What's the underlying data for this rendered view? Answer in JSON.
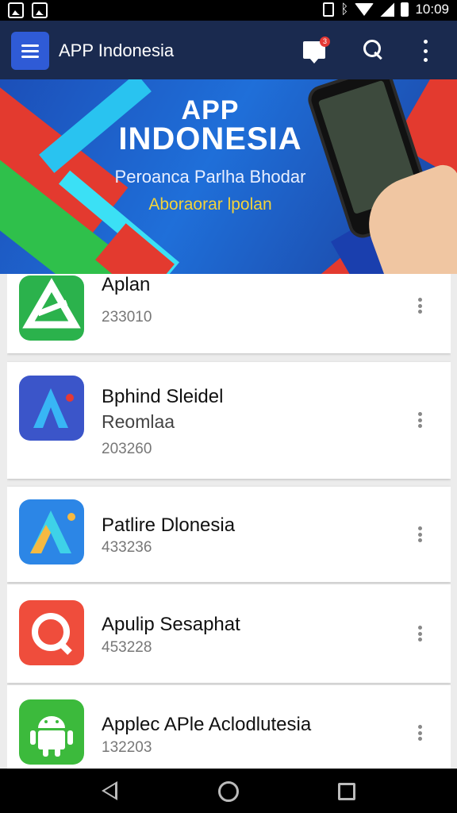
{
  "status_bar": {
    "time": "10:09"
  },
  "app_bar": {
    "title": "APP Indonesia",
    "notification_count": "3",
    "icons": [
      "menu-icon",
      "message-icon",
      "search-icon",
      "more-vert-icon"
    ]
  },
  "banner": {
    "line1": "APP",
    "line2": "INDONESIA",
    "subtitle": "Peroanca Parlha Bhodar",
    "tagline": "Aboraorar lpolan",
    "slides": 4,
    "active_slide": 0
  },
  "apps": [
    {
      "name": "Aplan",
      "subtitle": "",
      "number": "233010",
      "icon": "triangle-logo-icon",
      "color": "#2bb24c"
    },
    {
      "name": "Bphind Sleidel",
      "subtitle": "Reomlaa",
      "number": "203260",
      "icon": "letter-a-logo-icon",
      "color": "#3b55c9"
    },
    {
      "name": "Patlire Dlonesia",
      "subtitle": "",
      "number": "433236",
      "icon": "letter-a-logo-icon",
      "color": "#2c86e6"
    },
    {
      "name": "Apulip Sesaphat",
      "subtitle": "",
      "number": "453228",
      "icon": "speech-logo-icon",
      "color": "#ef4d3c"
    },
    {
      "name": "Applec APle Aclodlutesia",
      "subtitle": "",
      "number": "132203",
      "icon": "android-icon",
      "color": "#3cba3c"
    }
  ],
  "colors": {
    "appbar": "#1a2a4f",
    "accent": "#2f5bd6",
    "badge": "#e53935"
  }
}
